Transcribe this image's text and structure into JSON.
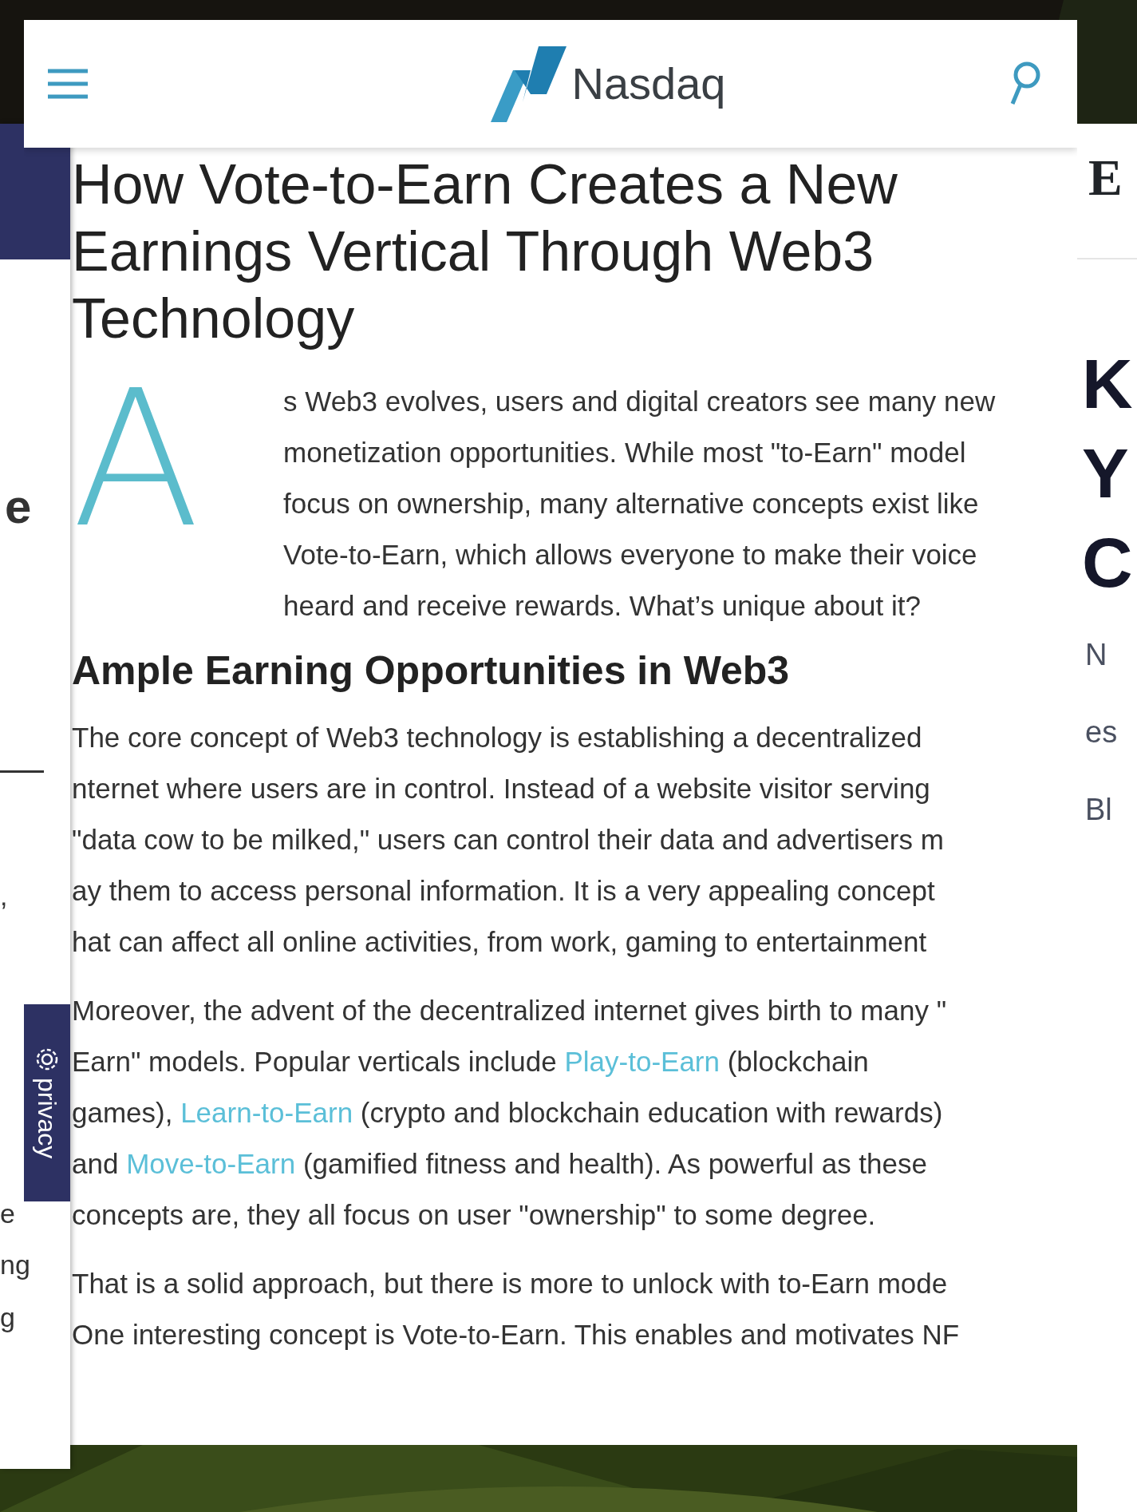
{
  "header": {
    "logo": "Nasdaq"
  },
  "article": {
    "title_lines": [
      "How Vote-to-Earn Creates a New",
      "Earnings Vertical Through Web3",
      "Technology"
    ],
    "drop_cap": "A",
    "intro_lines": [
      "s Web3 evolves, users and digital creators see many new",
      "monetization opportunities. While most \"to-Earn\" model",
      "focus on ownership, many alternative concepts exist like",
      "Vote-to-Earn, which allows everyone to make their voice",
      "heard and receive rewards. What’s unique about it?"
    ],
    "heading": "Ample Earning Opportunities in Web3",
    "paragraphs": [
      [
        [
          {
            "kind": "text",
            "text": "The core concept of Web3 technology is establishing a decentralized"
          }
        ],
        [
          {
            "kind": "text",
            "text": "nternet where users are in control. Instead of a website visitor serving"
          }
        ],
        [
          {
            "kind": "text",
            "text": "\"data cow to be milked,\" users can control their data and advertisers m"
          }
        ],
        [
          {
            "kind": "text",
            "text": "ay them to access personal information. It is a very appealing concept"
          }
        ],
        [
          {
            "kind": "text",
            "text": "hat can affect all online activities, from work, gaming to entertainment"
          }
        ]
      ],
      [
        [
          {
            "kind": "text",
            "text": "Moreover, the advent of the decentralized internet gives birth to many \""
          }
        ],
        [
          {
            "kind": "text",
            "text": "Earn\" models. Popular verticals include "
          },
          {
            "kind": "link",
            "text": "Play-to-Earn"
          },
          {
            "kind": "text",
            "text": " (blockchain"
          }
        ],
        [
          {
            "kind": "text",
            "text": "games), "
          },
          {
            "kind": "link",
            "text": "Learn-to-Earn"
          },
          {
            "kind": "text",
            "text": " (crypto and blockchain education with rewards)"
          }
        ],
        [
          {
            "kind": "text",
            "text": "and "
          },
          {
            "kind": "link",
            "text": "Move-to-Earn"
          },
          {
            "kind": "text",
            "text": " (gamified fitness and health). As powerful as these"
          }
        ],
        [
          {
            "kind": "text",
            "text": "concepts are, they all focus on user \"ownership\" to some degree."
          }
        ]
      ],
      [
        [
          {
            "kind": "text",
            "text": "That is a solid approach, but there is more to unlock with to-Earn mode"
          }
        ],
        [
          {
            "kind": "text",
            "text": "One interesting concept is Vote-to-Earn. This enables and motivates NF"
          }
        ]
      ]
    ]
  },
  "left_card": {
    "fragments": [
      {
        "kind": "bold",
        "text": "e"
      },
      {
        "kind": "plain",
        "text": ","
      },
      {
        "kind": "plain",
        "text": "e"
      },
      {
        "kind": "plain",
        "text": "ng"
      },
      {
        "kind": "plain",
        "text": "g"
      }
    ]
  },
  "privacy_tab": {
    "label": "privacy"
  },
  "right_card": {
    "masthead": "E",
    "headline_lines": [
      "K",
      "Y",
      "C"
    ],
    "summary_lines": [
      "N",
      "es",
      "Bl"
    ]
  }
}
